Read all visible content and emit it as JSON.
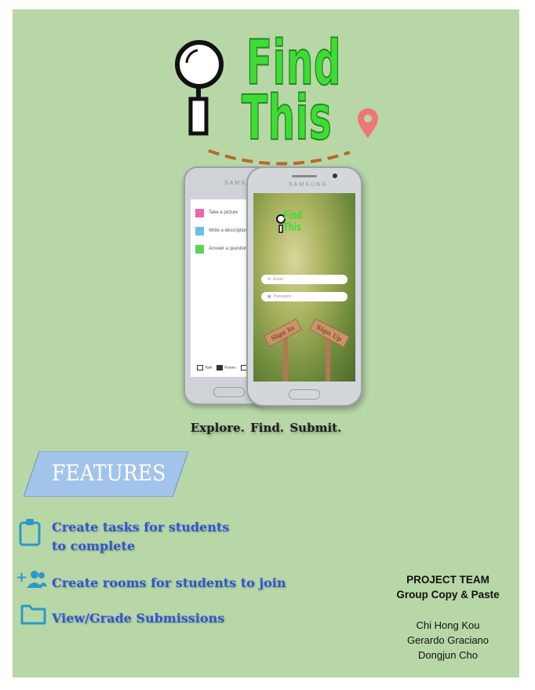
{
  "logo": {
    "line1": "Find",
    "line2": "This"
  },
  "phones": {
    "brand": "SAMSUNG",
    "back_screen": {
      "rows": [
        "Take a picture",
        "Write a description",
        "Answer a question"
      ],
      "tabs": [
        "Task",
        "Rooms",
        "Sub"
      ]
    },
    "front_screen": {
      "logo_line1": "Find",
      "logo_line2": "This",
      "email_placeholder": "Email",
      "password_placeholder": "Password",
      "sign_in": "Sign In",
      "sign_up": "Sign Up"
    }
  },
  "tagline": "Explore.  Find.  Submit.",
  "features": {
    "heading": "FEATURES",
    "items": [
      {
        "icon": "clipboard-icon",
        "line1": "Create tasks for students",
        "line2": "to complete"
      },
      {
        "icon": "add-people-icon",
        "line1": "Create rooms for students to join"
      },
      {
        "icon": "folder-icon",
        "line1": "View/Grade Submissions"
      }
    ]
  },
  "team": {
    "heading": "PROJECT TEAM",
    "group": "Group Copy & Paste",
    "members": [
      "Chi Hong Kou",
      "Gerardo Graciano",
      "Dongjun Cho"
    ]
  },
  "colors": {
    "background": "#b8d7a6",
    "logo_green": "#3fdc37",
    "feature_blue": "#2f55d4",
    "banner_blue": "#a3c4ea",
    "pin_coral": "#f07575",
    "dash_brown": "#b8692c"
  }
}
